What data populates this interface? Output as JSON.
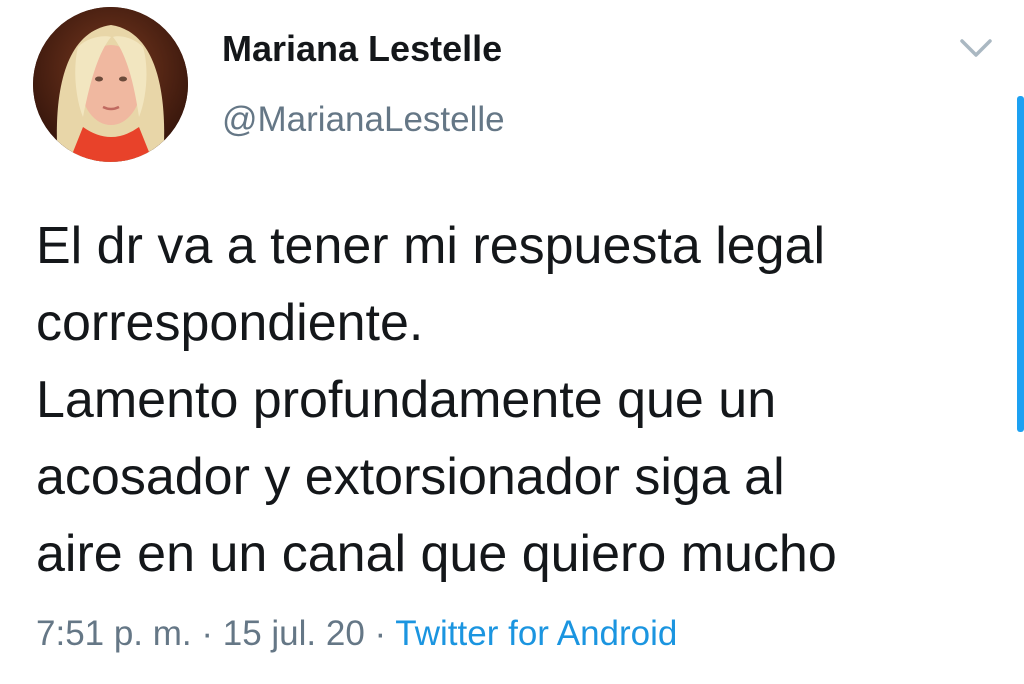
{
  "author": {
    "display_name": "Mariana Lestelle",
    "handle": "@MarianaLestelle"
  },
  "tweet": {
    "lines": [
      "El dr va a tener mi respuesta legal",
      "correspondiente.",
      "Lamento profundamente que un",
      "acosador y extorsionador siga al",
      "aire en un canal que quiero mucho"
    ]
  },
  "meta": {
    "time": "7:51 p. m.",
    "separator1": " · ",
    "date": "15 jul. 20",
    "separator2": " · ",
    "source": "Twitter for Android"
  },
  "colors": {
    "accent": "#1da1f2",
    "link": "#1b95e0",
    "secondary_text": "#657786",
    "primary_text": "#14171a"
  },
  "icons": {
    "menu": "chevron-down-icon",
    "avatar": "profile-photo"
  }
}
